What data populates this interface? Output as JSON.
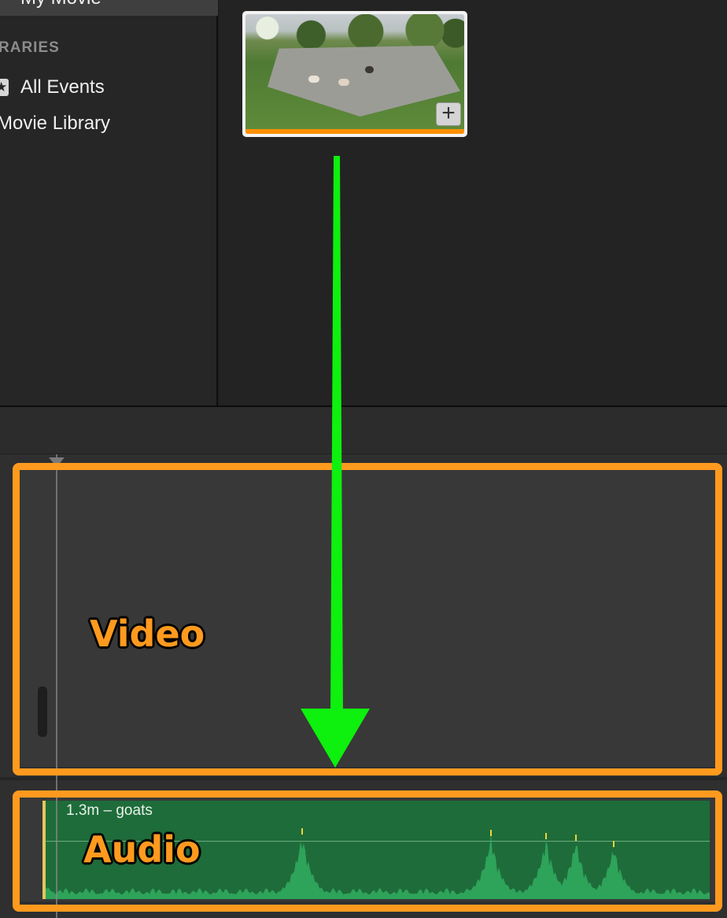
{
  "sidebar": {
    "selected_project": "My Movie",
    "section_title": "RARIES",
    "items": [
      {
        "label": "All Events",
        "icon": "star-icon"
      },
      {
        "label": "Movie Library"
      }
    ]
  },
  "browser": {
    "clip": {
      "thumbnail": "goats",
      "add_icon": "plus-icon"
    }
  },
  "timeline": {
    "audio_clip": {
      "title": "1.3m – goats"
    }
  },
  "annotations": {
    "video_label": "Video",
    "audio_label": "Audio",
    "arrow_color": "#0ef00e",
    "box_color": "#ff9a1e"
  },
  "colors": {
    "audio_clip": "#1e6c3a",
    "waveform": "#2ea35a",
    "range_selection": "#ff9000"
  }
}
